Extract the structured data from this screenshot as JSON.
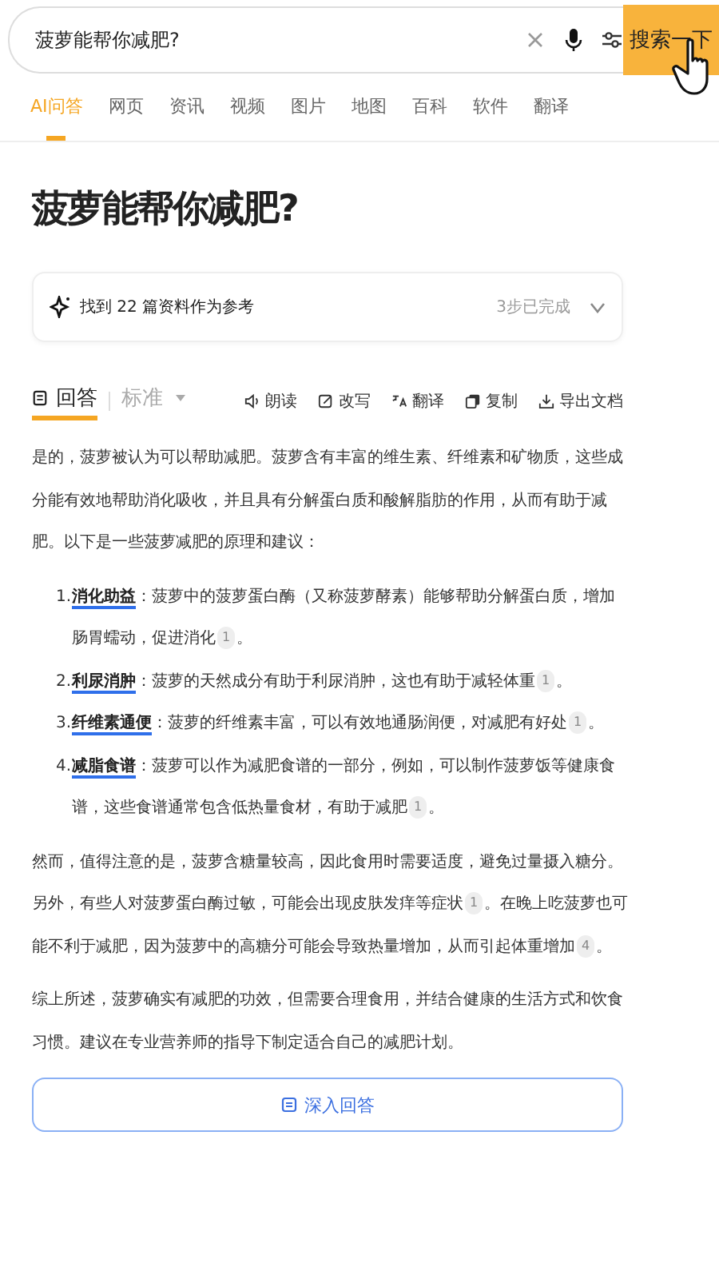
{
  "search": {
    "value": "菠萝能帮你减肥?",
    "button": "搜索一下"
  },
  "tabs": [
    {
      "label": "AI问答",
      "selected": true
    },
    {
      "label": "网页",
      "selected": false
    },
    {
      "label": "资讯",
      "selected": false
    },
    {
      "label": "视频",
      "selected": false
    },
    {
      "label": "图片",
      "selected": false
    },
    {
      "label": "地图",
      "selected": false
    },
    {
      "label": "百科",
      "selected": false
    },
    {
      "label": "软件",
      "selected": false
    },
    {
      "label": "翻译",
      "selected": false
    }
  ],
  "title": "菠萝能帮你减肥?",
  "sources": {
    "text": "找到 22 篇资料作为参考",
    "status": "3步已完成",
    "expanded": false
  },
  "answer_tabs": [
    {
      "label": "回答",
      "selected": true
    },
    {
      "label": "标准",
      "selected": false
    }
  ],
  "actions": [
    {
      "kind": "read",
      "label": "朗读"
    },
    {
      "kind": "rewrite",
      "label": "改写"
    },
    {
      "kind": "translate",
      "label": "翻译"
    },
    {
      "kind": "copy",
      "label": "复制"
    },
    {
      "kind": "export",
      "label": "导出文档"
    }
  ],
  "blocks": [
    {
      "kind": "paragraph",
      "segments": [
        {
          "kind": "text",
          "text": "是的，菠萝被认为可以帮助减肥。菠萝含有丰富的维生素、纤维素和矿物质，这些成分能有效地帮助消化吸收，并且具有分解蛋白质和酸解脂肪的作用，从而有助于减肥。以下是一些菠萝减肥的原理和建议："
        }
      ]
    },
    {
      "kind": "list",
      "items": [
        {
          "number": "1.",
          "term": "消化助益",
          "segments": [
            {
              "kind": "text",
              "text": "：菠萝中的菠萝蛋白酶（又称菠萝酵素）能够帮助分解蛋白质，增加肠胃蠕动，促进消化"
            },
            {
              "kind": "cite",
              "text": "1"
            },
            {
              "kind": "text",
              "text": "。"
            }
          ]
        },
        {
          "number": "2.",
          "term": "利尿消肿",
          "segments": [
            {
              "kind": "text",
              "text": "：菠萝的天然成分有助于利尿消肿，这也有助于减轻体重"
            },
            {
              "kind": "cite",
              "text": "1"
            },
            {
              "kind": "text",
              "text": "。"
            }
          ]
        },
        {
          "number": "3.",
          "term": "纤维素通便",
          "segments": [
            {
              "kind": "text",
              "text": "：菠萝的纤维素丰富，可以有效地通肠润便，对减肥有好处"
            },
            {
              "kind": "cite",
              "text": "1"
            },
            {
              "kind": "text",
              "text": "。"
            }
          ]
        },
        {
          "number": "4.",
          "term": "减脂食谱",
          "segments": [
            {
              "kind": "text",
              "text": "：菠萝可以作为减肥食谱的一部分，例如，可以制作菠萝饭等健康食谱，这些食谱通常包含低热量食材，有助于减肥"
            },
            {
              "kind": "cite",
              "text": "1"
            },
            {
              "kind": "text",
              "text": "。"
            }
          ]
        }
      ]
    },
    {
      "kind": "paragraph",
      "segments": [
        {
          "kind": "text",
          "text": "然而，值得注意的是，菠萝含糖量较高，因此食用时需要适度，避免过量摄入糖分。另外，有些人对菠萝蛋白酶过敏，可能会出现皮肤发痒等症状"
        },
        {
          "kind": "cite",
          "text": "1"
        },
        {
          "kind": "text",
          "text": "。在晚上吃菠萝也可能不利于减肥，因为菠萝中的高糖分可能会导致热量增加，从而引起体重增加"
        },
        {
          "kind": "cite",
          "text": "4"
        },
        {
          "kind": "text",
          "text": "。"
        }
      ]
    },
    {
      "kind": "paragraph",
      "segments": [
        {
          "kind": "text",
          "text": "综上所述，菠萝确实有减肥的功效，但需要合理食用，并结合健康的生活方式和饮食习惯。建议在专业营养师的指导下制定适合自己的减肥计划。"
        }
      ]
    }
  ],
  "deep_button": "深入回答"
}
